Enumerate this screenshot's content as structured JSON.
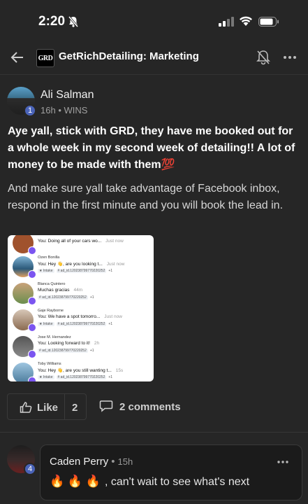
{
  "status_bar": {
    "time": "2:20"
  },
  "header": {
    "group_name": "GetRichDetailing: Marketing",
    "logo_text": "GRD"
  },
  "post": {
    "author": "Ali Salman",
    "level": "1",
    "time": "16h",
    "separator": "•",
    "category": "WINS",
    "title": "Aye yall, stick with GRD, they have me booked out for a whole week in my second week of detailing!! A lot of money to be made with them",
    "title_emoji": "💯",
    "body": "And make sure yall take advantage of Facebook inbox, respond in the first minute and you will book the lead in.",
    "image": {
      "messages": [
        {
          "name": "",
          "text": "You: Doing all of your cars wo...",
          "time": "Just now",
          "tags": []
        },
        {
          "name": "Ozen Bonilla",
          "text": "You: Hey 👋, are you looking t...",
          "time": "Just now",
          "tags": [
            "★ Intake",
            "# ad_id.120238799770220252",
            "+1"
          ]
        },
        {
          "name": "Blanca Quintero",
          "text": "Muchas gracias",
          "time": "44m",
          "tags": [
            "# ad_id.120238799770220252",
            "+1"
          ]
        },
        {
          "name": "Gaje Rayborne",
          "text": "You: We have a spot tomorro...",
          "time": "Just now",
          "tags": [
            "★ Intake",
            "# ad_id.120238799770220252",
            "+1"
          ]
        },
        {
          "name": "Jose M. Hernandez",
          "text": "You: Looking forward to it!",
          "time": "2h",
          "tags": [
            "# ad_id.120238799770220252",
            "+1"
          ]
        },
        {
          "name": "Toby Williams",
          "text": "You: Hey 👋, are you still wanting t...",
          "time": "15s",
          "tags": [
            "★ Intake",
            "# ad_id.120238799770220252",
            "+1"
          ]
        }
      ]
    },
    "like_label": "Like",
    "like_count": "2",
    "comments_label": "2 comments"
  },
  "comment": {
    "author": "Caden Perry",
    "level": "4",
    "separator": "•",
    "time": "15h",
    "emojis": "🔥 🔥 🔥",
    "text": ", can't wait to see what's next"
  },
  "colors": {
    "background": "#262626",
    "level_badge": "#4a63b8",
    "messenger_badge": "#7b55f0"
  }
}
